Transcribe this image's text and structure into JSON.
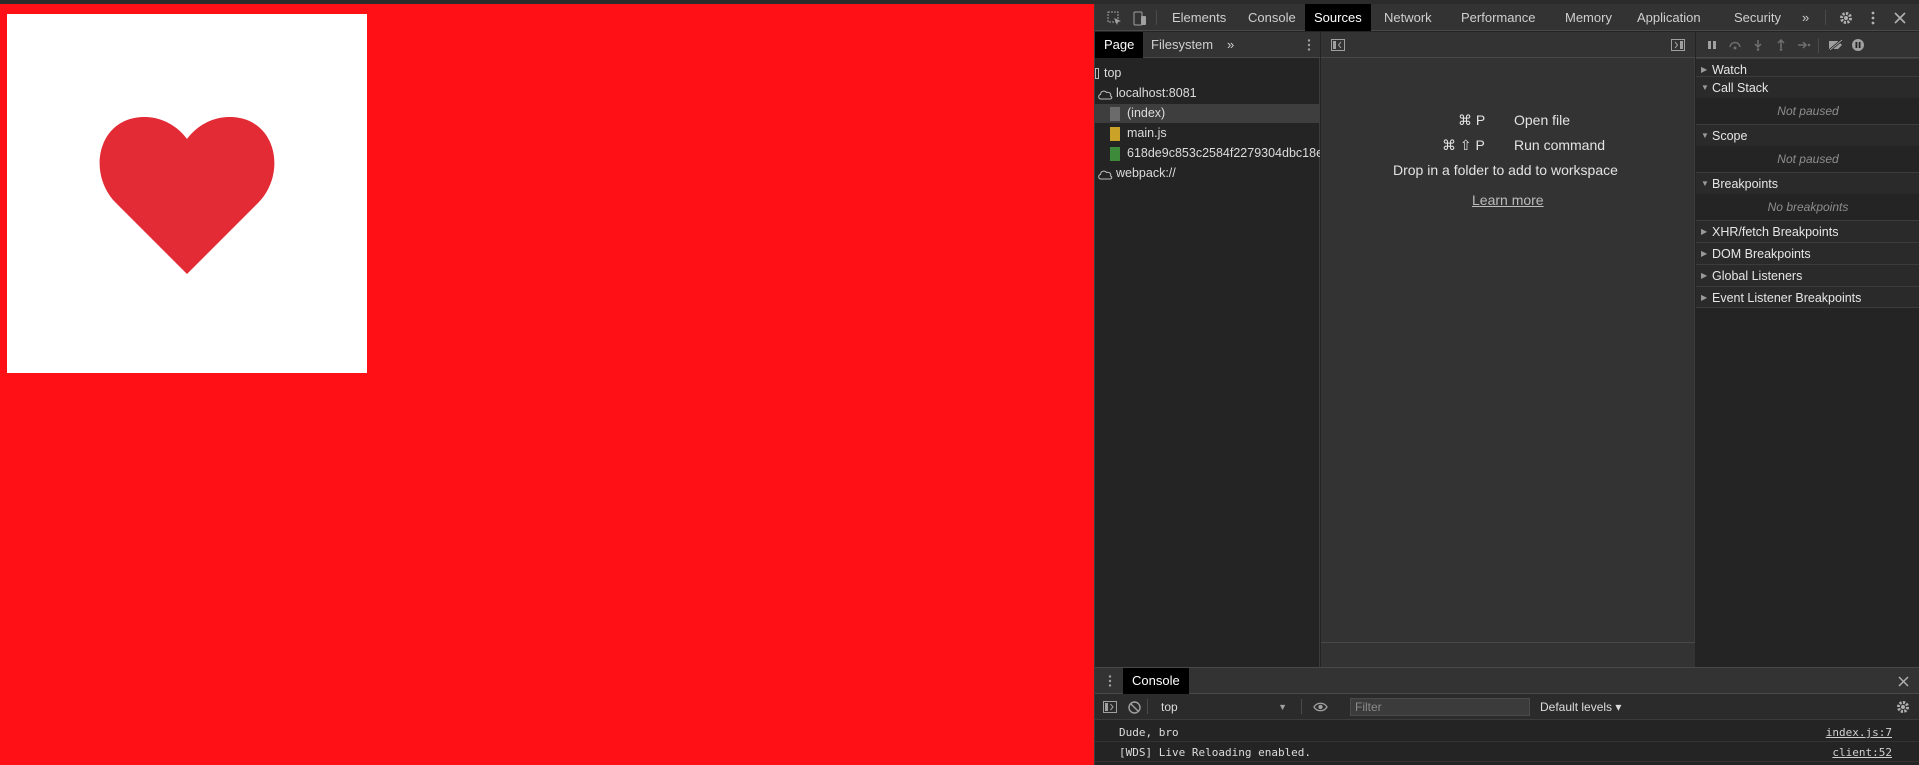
{
  "viewport": {
    "background_color": "#ff1016",
    "card_color": "#ffffff",
    "heart_color": "#e32b36"
  },
  "toolbar": {
    "tabs": [
      "Elements",
      "Console",
      "Sources",
      "Network",
      "Performance",
      "Memory",
      "Application",
      "Security"
    ],
    "active_tab": "Sources",
    "more_label": "»"
  },
  "navigator": {
    "tabs": [
      "Page",
      "Filesystem"
    ],
    "active_tab": "Page",
    "more_label": "»",
    "tree": {
      "top": "top",
      "host": "localhost:8081",
      "files": [
        "(index)",
        "main.js",
        "618de9c853c2584f2279304dbc18e"
      ],
      "webpack": "webpack://"
    }
  },
  "editor": {
    "open_file_keys": "⌘ P",
    "open_file_label": "Open file",
    "run_command_keys": "⌘ ⇧ P",
    "run_command_label": "Run command",
    "drop_hint": "Drop in a folder to add to workspace",
    "learn_more": "Learn more"
  },
  "debugger": {
    "watch": "Watch",
    "call_stack": "Call Stack",
    "call_stack_status": "Not paused",
    "scope": "Scope",
    "scope_status": "Not paused",
    "breakpoints": "Breakpoints",
    "breakpoints_status": "No breakpoints",
    "xhr": "XHR/fetch Breakpoints",
    "dom": "DOM Breakpoints",
    "global": "Global Listeners",
    "event": "Event Listener Breakpoints"
  },
  "drawer": {
    "tab": "Console",
    "context": "top",
    "filter_placeholder": "Filter",
    "levels": "Default levels ▾",
    "messages": [
      {
        "text": "Dude, bro",
        "source": "index.js:7"
      },
      {
        "text": "[WDS] Live Reloading enabled.",
        "source": "client:52"
      }
    ]
  }
}
